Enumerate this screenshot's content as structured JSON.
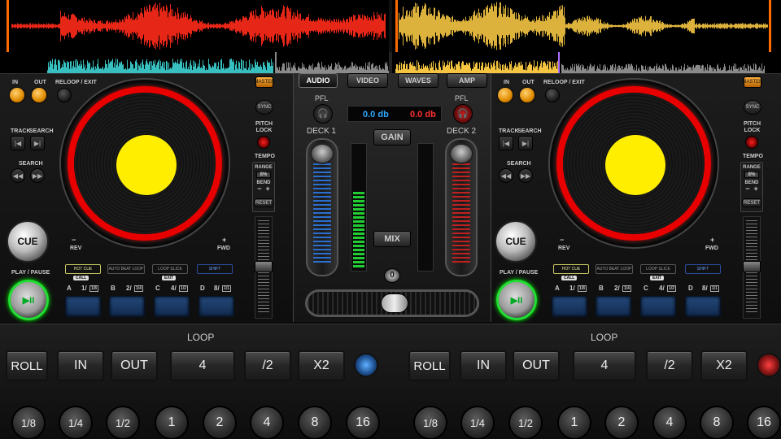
{
  "waveforms": {
    "left_color": "#ff2a1a",
    "right_color": "#f5c542",
    "left_sub_color": "#38c0c0",
    "right_sub_color": "#8a8a8a"
  },
  "deck_left": {
    "in_label": "IN",
    "out_label": "OUT",
    "reloop_label": "RELOOP / EXIT",
    "master_label": "MASTER",
    "sync_label": "SYNC",
    "pitch_lock_label": "PITCH\nLOCK",
    "track_label": "TRACK",
    "search_label": "SEARCH",
    "search2_label": "SEARCH",
    "tempo_label": "TEMPO",
    "range_label": "RANGE",
    "range_value": "8%",
    "bend_label": "BEND",
    "bend_minus": "−",
    "bend_plus": "+",
    "reset_label": "RESET",
    "rev_label": "REV",
    "fwd_label": "FWD",
    "minus": "−",
    "plus": "+",
    "cue_label": "CUE",
    "play_pause_label": "PLAY / PAUSE",
    "fx": [
      "HOT CUE",
      "AUTO BEAT LOOP",
      "LOOP SLICE",
      "SHIFT"
    ],
    "fx_sub": [
      "CALL",
      "",
      "EXIT",
      ""
    ],
    "pads": [
      {
        "letter": "A",
        "num": "1/",
        "box": "1/8"
      },
      {
        "letter": "B",
        "num": "2/",
        "box": "1/4"
      },
      {
        "letter": "C",
        "num": "4/",
        "box": "1/2"
      },
      {
        "letter": "D",
        "num": "8/",
        "box": "1/1"
      }
    ]
  },
  "deck_right": {
    "in_label": "IN",
    "out_label": "OUT",
    "reloop_label": "RELOOP / EXIT",
    "master_label": "MASTER",
    "sync_label": "SYNC",
    "pitch_lock_label": "PITCH\nLOCK",
    "track_label": "TRACK",
    "search_label": "SEARCH",
    "search2_label": "SEARCH",
    "tempo_label": "TEMPO",
    "range_label": "RANGE",
    "range_value": "8%",
    "bend_label": "BEND",
    "bend_minus": "−",
    "bend_plus": "+",
    "reset_label": "RESET",
    "rev_label": "REV",
    "fwd_label": "FWD",
    "minus": "−",
    "plus": "+",
    "cue_label": "CUE",
    "play_pause_label": "PLAY / PAUSE",
    "fx": [
      "HOT CUE",
      "AUTO BEAT LOOP",
      "LOOP SLICE",
      "SHIFT"
    ],
    "fx_sub": [
      "CALL",
      "",
      "EXIT",
      ""
    ],
    "pads": [
      {
        "letter": "A",
        "num": "1/",
        "box": "1/8"
      },
      {
        "letter": "B",
        "num": "2/",
        "box": "1/4"
      },
      {
        "letter": "C",
        "num": "4/",
        "box": "1/2"
      },
      {
        "letter": "D",
        "num": "8/",
        "box": "1/1"
      }
    ]
  },
  "mixer": {
    "tabs": [
      "AUDIO",
      "VIDEO",
      "WAVES",
      "AMP"
    ],
    "pfl": "PFL",
    "db_left": "0.0 db",
    "db_right": "0.0 db",
    "deck1": "DECK 1",
    "deck2": "DECK 2",
    "gain": "GAIN",
    "mix": "MIX",
    "zero": "0",
    "db_left_color": "#2ea8ff",
    "db_right_color": "#ff3030"
  },
  "loop_left": {
    "title": "LOOP",
    "roll": "ROLL",
    "in": "IN",
    "out": "OUT",
    "size": "4",
    "half": "/2",
    "double": "X2",
    "beats": [
      "1/8",
      "1/4",
      "1/2",
      "1",
      "2",
      "4",
      "8",
      "16"
    ]
  },
  "loop_right": {
    "title": "LOOP",
    "roll": "ROLL",
    "in": "IN",
    "out": "OUT",
    "size": "4",
    "half": "/2",
    "double": "X2",
    "beats": [
      "1/8",
      "1/4",
      "1/2",
      "1",
      "2",
      "4",
      "8",
      "16"
    ]
  }
}
